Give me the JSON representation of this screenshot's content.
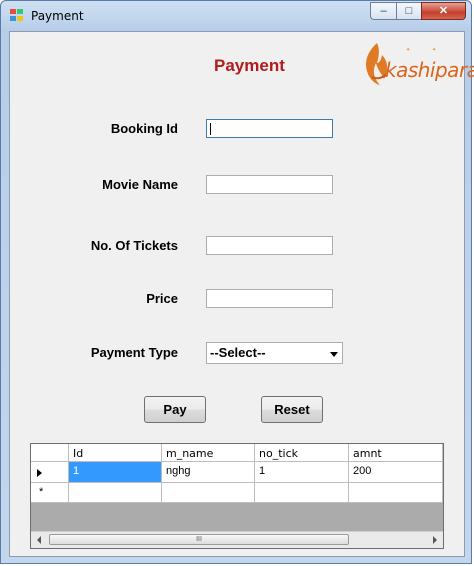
{
  "window": {
    "title": "Payment",
    "buttons": {
      "minimize": "–",
      "maximize": "□",
      "close": "✕"
    }
  },
  "form": {
    "heading": "Payment",
    "logo": {
      "text": "kashipara",
      "icon": "kashipara-logo"
    },
    "fields": {
      "booking_id": {
        "label": "Booking Id",
        "value": ""
      },
      "movie_name": {
        "label": "Movie Name",
        "value": ""
      },
      "no_of_tickets": {
        "label": "No. Of Tickets",
        "value": ""
      },
      "price": {
        "label": "Price",
        "value": ""
      },
      "payment_type": {
        "label": "Payment Type",
        "selected": "--Select--"
      }
    },
    "buttons": {
      "pay": "Pay",
      "reset": "Reset"
    }
  },
  "grid": {
    "columns": [
      "Id",
      "m_name",
      "no_tick",
      "amnt"
    ],
    "rows": [
      {
        "values": [
          "1",
          "nghg",
          "1",
          "200"
        ]
      }
    ],
    "new_row_marker": "*",
    "scroll_label": "III"
  },
  "colors": {
    "heading": "#b01c1c",
    "logo": "#d9651a",
    "selection": "#3399ff"
  }
}
